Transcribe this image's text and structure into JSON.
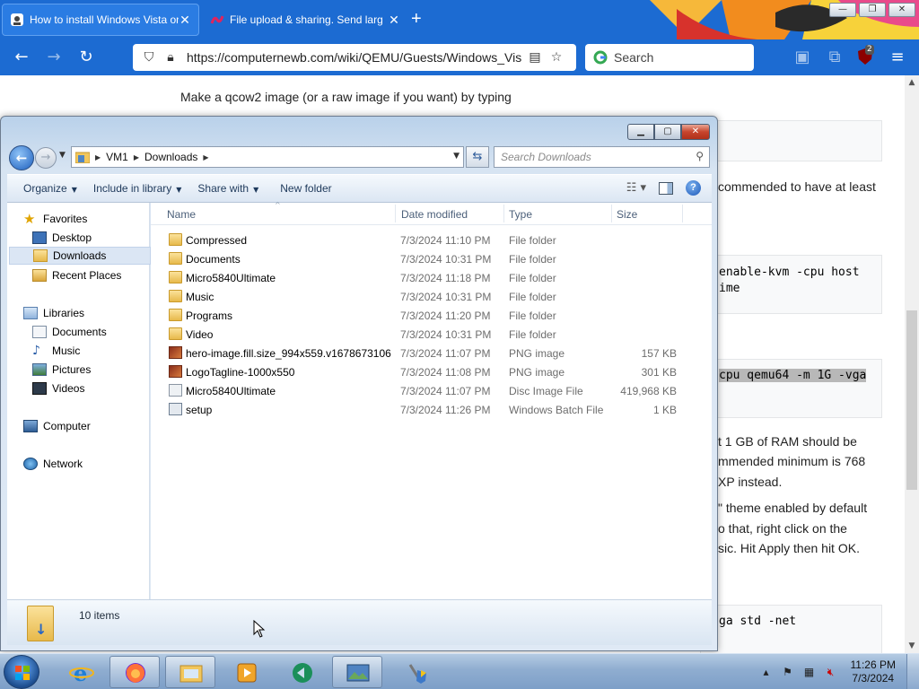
{
  "browser": {
    "tabs": [
      {
        "title": "How to install Windows Vista on"
      },
      {
        "title": "File upload & sharing. Send larg"
      }
    ],
    "url": "https://computernewb.com/wiki/QEMU/Guests/Windows_Vis",
    "search_placeholder": "Search",
    "extension_badge": "2"
  },
  "webpage": {
    "intro": "Make a qcow2 image (or a raw image if you want) by typing",
    "fragments": {
      "recommended": "commended to have at least",
      "cmd1_line1": "enable-kvm -cpu host",
      "cmd1_line2": "ime",
      "cmd2": "cpu qemu64 -m 1G -vga",
      "ram1": "t 1 GB of RAM should be",
      "ram2": "mmended minimum is 768",
      "ram3": "XP instead.",
      "theme1": "\" theme enabled by default",
      "theme2": "o that, right click on the",
      "theme3": "sic. Hit Apply then hit OK.",
      "cmd3": "ga std -net"
    }
  },
  "explorer": {
    "path": [
      "VM1",
      "Downloads"
    ],
    "search_placeholder": "Search Downloads",
    "toolbar": {
      "organize": "Organize",
      "include_in_library": "Include in library",
      "share_with": "Share with",
      "new_folder": "New folder"
    },
    "nav": {
      "favorites": "Favorites",
      "desktop": "Desktop",
      "downloads": "Downloads",
      "recent_places": "Recent Places",
      "libraries": "Libraries",
      "documents": "Documents",
      "music": "Music",
      "pictures": "Pictures",
      "videos": "Videos",
      "computer": "Computer",
      "network": "Network"
    },
    "columns": {
      "name": "Name",
      "date": "Date modified",
      "type": "Type",
      "size": "Size"
    },
    "files": [
      {
        "name": "Compressed",
        "date": "7/3/2024 11:10 PM",
        "type": "File folder",
        "size": "",
        "icon": "folder-icon"
      },
      {
        "name": "Documents",
        "date": "7/3/2024 10:31 PM",
        "type": "File folder",
        "size": "",
        "icon": "folder-icon"
      },
      {
        "name": "Micro5840Ultimate",
        "date": "7/3/2024 11:18 PM",
        "type": "File folder",
        "size": "",
        "icon": "folder-icon"
      },
      {
        "name": "Music",
        "date": "7/3/2024 10:31 PM",
        "type": "File folder",
        "size": "",
        "icon": "folder-icon"
      },
      {
        "name": "Programs",
        "date": "7/3/2024 11:20 PM",
        "type": "File folder",
        "size": "",
        "icon": "folder-icon"
      },
      {
        "name": "Video",
        "date": "7/3/2024 10:31 PM",
        "type": "File folder",
        "size": "",
        "icon": "folder-icon"
      },
      {
        "name": "hero-image.fill.size_994x559.v1678673106",
        "date": "7/3/2024 11:07 PM",
        "type": "PNG image",
        "size": "157 KB",
        "icon": "png-image-icon"
      },
      {
        "name": "LogoTagline-1000x550",
        "date": "7/3/2024 11:08 PM",
        "type": "PNG image",
        "size": "301 KB",
        "icon": "png-image-icon"
      },
      {
        "name": "Micro5840Ultimate",
        "date": "7/3/2024 11:07 PM",
        "type": "Disc Image File",
        "size": "419,968 KB",
        "icon": "disc-image-icon"
      },
      {
        "name": "setup",
        "date": "7/3/2024 11:26 PM",
        "type": "Windows Batch File",
        "size": "1 KB",
        "icon": "batch-file-icon"
      }
    ],
    "status": "10 items"
  },
  "taskbar": {
    "time": "11:26 PM",
    "date": "7/3/2024"
  }
}
